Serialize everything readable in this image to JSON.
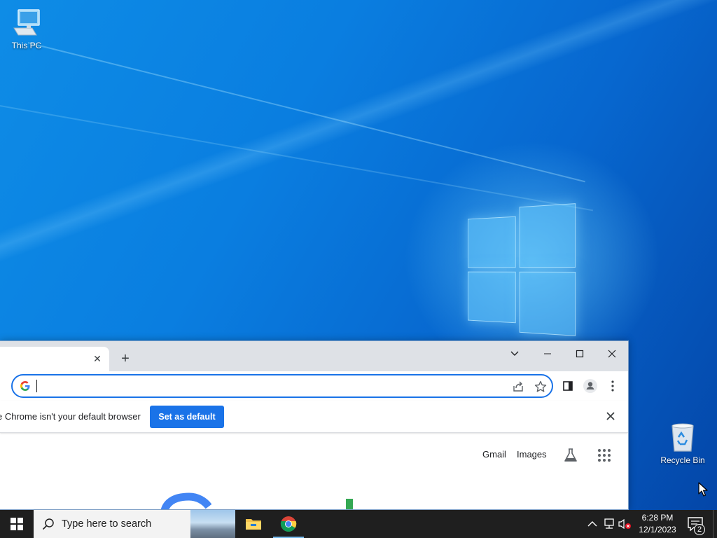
{
  "desktop": {
    "icons": [
      {
        "label": "This PC",
        "icon": "this-pc-icon"
      },
      {
        "label": "Recycle Bin",
        "icon": "recycle-bin-icon"
      }
    ]
  },
  "chrome": {
    "tab_close": "✕",
    "new_tab": "+",
    "omnibox": {
      "value": "",
      "placeholder": ""
    },
    "infobar": {
      "message": "e Chrome isn't your default browser",
      "button_label": "Set as default"
    },
    "ntp": {
      "gmail": "Gmail",
      "images": "Images"
    },
    "colors": {
      "accent": "#1a73e8",
      "tabstrip": "#dee1e6"
    }
  },
  "taskbar": {
    "search_placeholder": "Type here to search",
    "time": "6:28 PM",
    "date": "12/1/2023",
    "notification_count": "2",
    "apps": [
      "file-explorer-icon",
      "chrome-icon"
    ]
  }
}
